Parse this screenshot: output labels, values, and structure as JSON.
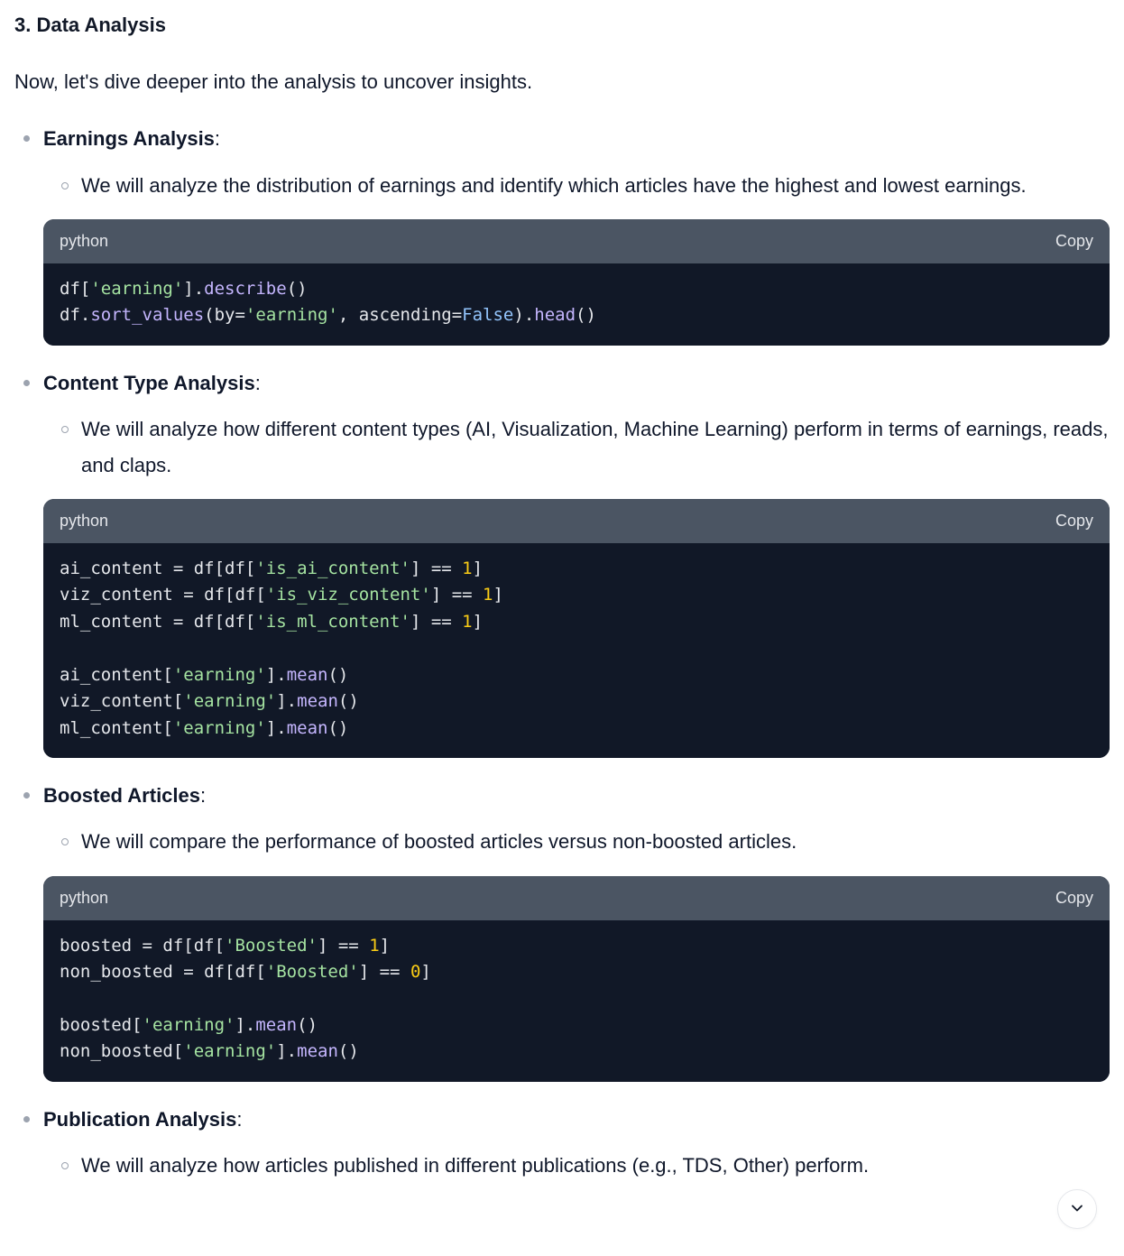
{
  "section": {
    "number": "3.",
    "title": "Data Analysis"
  },
  "intro": "Now, let's dive deeper into the analysis to uncover insights.",
  "code_lang": "python",
  "copy_label": "Copy",
  "items": [
    {
      "title": "Earnings Analysis",
      "colon": ":",
      "desc": "We will analyze the distribution of earnings and identify which articles have the highest and lowest earnings.",
      "code_tokens": [
        [
          "py",
          "df["
        ],
        [
          "str",
          "'earning'"
        ],
        [
          "py",
          "]."
        ],
        [
          "fn",
          "describe"
        ],
        [
          "py",
          "()"
        ],
        [
          "nl",
          ""
        ],
        [
          "py",
          "df."
        ],
        [
          "fn",
          "sort_values"
        ],
        [
          "py",
          "(by="
        ],
        [
          "str",
          "'earning'"
        ],
        [
          "py",
          ", ascending="
        ],
        [
          "kw",
          "False"
        ],
        [
          "py",
          ")."
        ],
        [
          "fn",
          "head"
        ],
        [
          "py",
          "()"
        ]
      ]
    },
    {
      "title": "Content Type Analysis",
      "colon": ":",
      "desc": "We will analyze how different content types (AI, Visualization, Machine Learning) perform in terms of earnings, reads, and claps.",
      "code_tokens": [
        [
          "py",
          "ai_content = df[df["
        ],
        [
          "str",
          "'is_ai_content'"
        ],
        [
          "py",
          "] == "
        ],
        [
          "num",
          "1"
        ],
        [
          "py",
          "]"
        ],
        [
          "nl",
          ""
        ],
        [
          "py",
          "viz_content = df[df["
        ],
        [
          "str",
          "'is_viz_content'"
        ],
        [
          "py",
          "] == "
        ],
        [
          "num",
          "1"
        ],
        [
          "py",
          "]"
        ],
        [
          "nl",
          ""
        ],
        [
          "py",
          "ml_content = df[df["
        ],
        [
          "str",
          "'is_ml_content'"
        ],
        [
          "py",
          "] == "
        ],
        [
          "num",
          "1"
        ],
        [
          "py",
          "]"
        ],
        [
          "nl",
          ""
        ],
        [
          "nl",
          ""
        ],
        [
          "py",
          "ai_content["
        ],
        [
          "str",
          "'earning'"
        ],
        [
          "py",
          "]."
        ],
        [
          "fn",
          "mean"
        ],
        [
          "py",
          "()"
        ],
        [
          "nl",
          ""
        ],
        [
          "py",
          "viz_content["
        ],
        [
          "str",
          "'earning'"
        ],
        [
          "py",
          "]."
        ],
        [
          "fn",
          "mean"
        ],
        [
          "py",
          "()"
        ],
        [
          "nl",
          ""
        ],
        [
          "py",
          "ml_content["
        ],
        [
          "str",
          "'earning'"
        ],
        [
          "py",
          "]."
        ],
        [
          "fn",
          "mean"
        ],
        [
          "py",
          "()"
        ]
      ]
    },
    {
      "title": "Boosted Articles",
      "colon": ":",
      "desc": "We will compare the performance of boosted articles versus non-boosted articles.",
      "code_tokens": [
        [
          "py",
          "boosted = df[df["
        ],
        [
          "str",
          "'Boosted'"
        ],
        [
          "py",
          "] == "
        ],
        [
          "num",
          "1"
        ],
        [
          "py",
          "]"
        ],
        [
          "nl",
          ""
        ],
        [
          "py",
          "non_boosted = df[df["
        ],
        [
          "str",
          "'Boosted'"
        ],
        [
          "py",
          "] == "
        ],
        [
          "num",
          "0"
        ],
        [
          "py",
          "]"
        ],
        [
          "nl",
          ""
        ],
        [
          "nl",
          ""
        ],
        [
          "py",
          "boosted["
        ],
        [
          "str",
          "'earning'"
        ],
        [
          "py",
          "]."
        ],
        [
          "fn",
          "mean"
        ],
        [
          "py",
          "()"
        ],
        [
          "nl",
          ""
        ],
        [
          "py",
          "non_boosted["
        ],
        [
          "str",
          "'earning'"
        ],
        [
          "py",
          "]."
        ],
        [
          "fn",
          "mean"
        ],
        [
          "py",
          "()"
        ]
      ]
    },
    {
      "title": "Publication Analysis",
      "colon": ":",
      "desc": "We will analyze how articles published in different publications (e.g., TDS, Other) perform.",
      "code_tokens": null
    }
  ]
}
